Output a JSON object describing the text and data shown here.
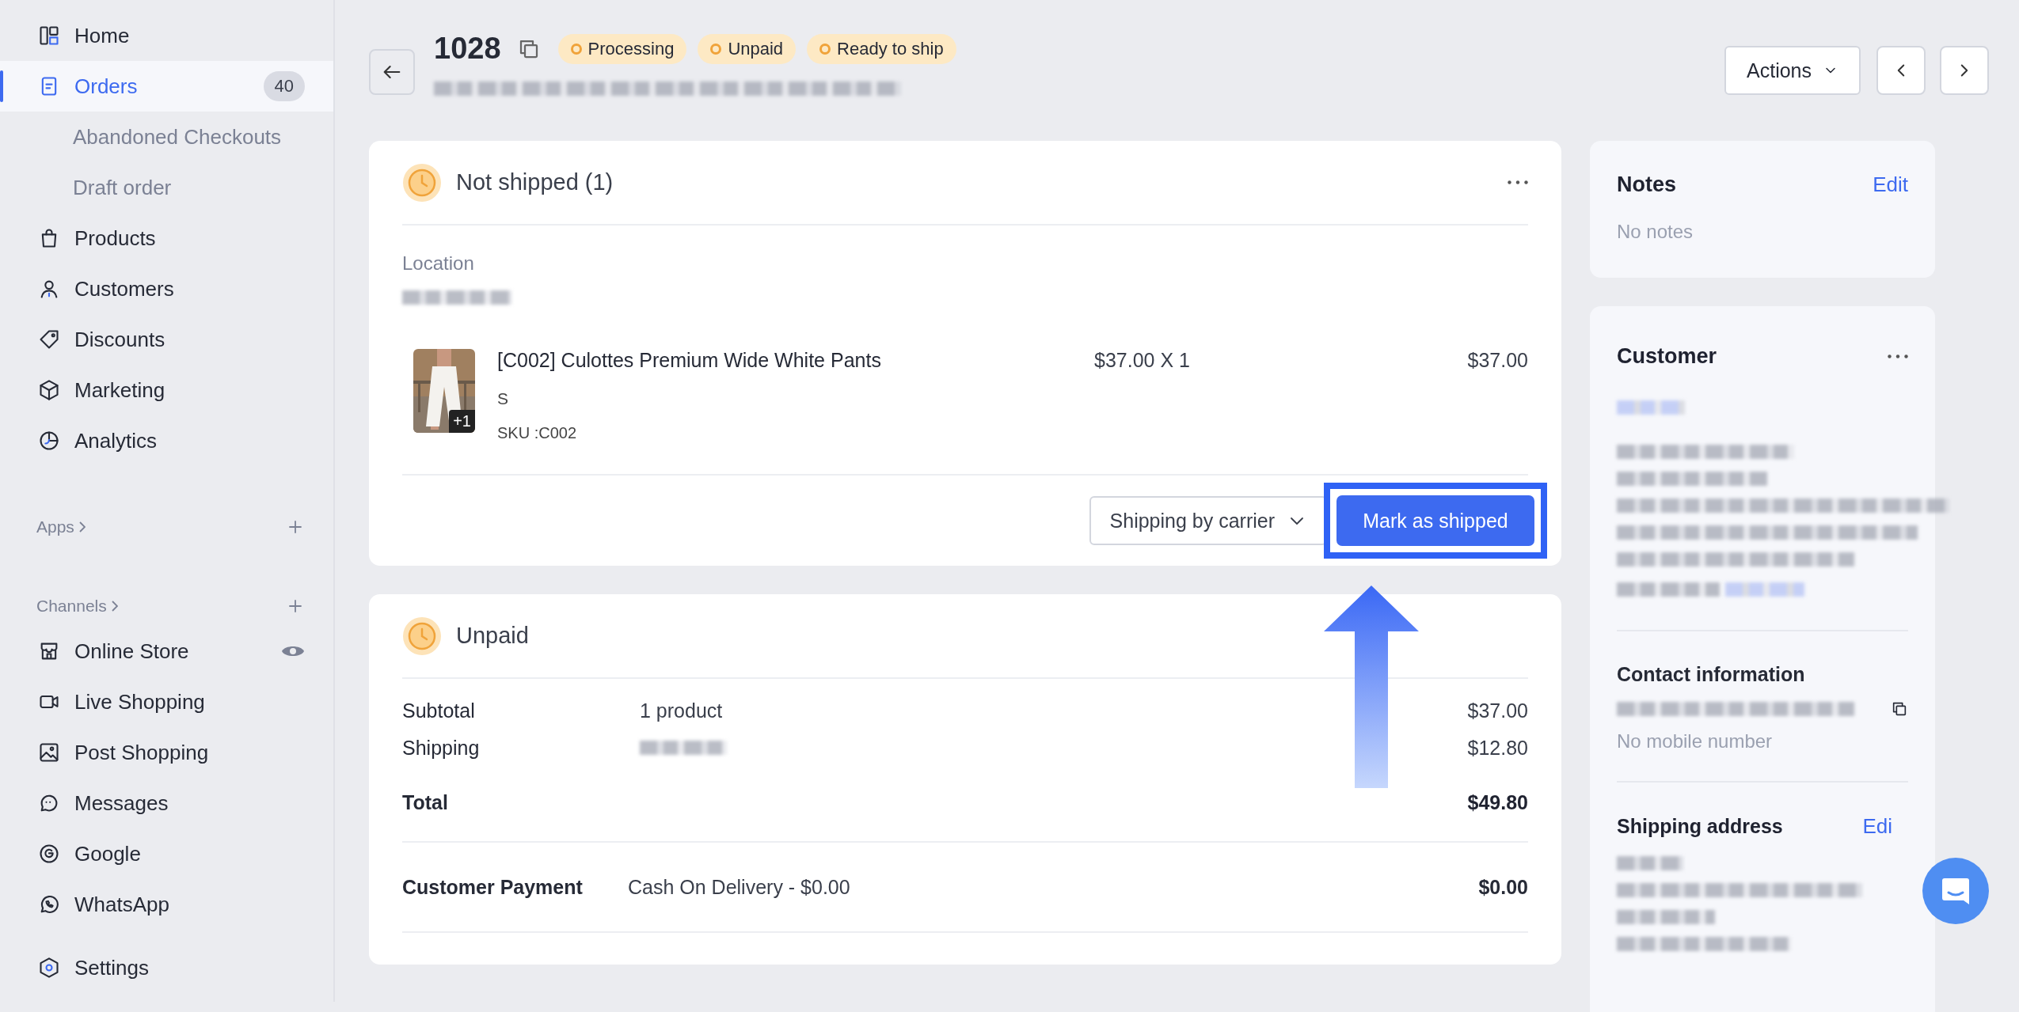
{
  "sidebar": {
    "items": [
      {
        "label": "Home",
        "kind": "main",
        "selected": false
      },
      {
        "label": "Orders",
        "kind": "main",
        "badge": "40",
        "selected": true
      },
      {
        "label": "Abandoned Checkouts",
        "kind": "sub",
        "selected": false
      },
      {
        "label": "Draft order",
        "kind": "sub",
        "selected": false
      },
      {
        "label": "Products",
        "kind": "main",
        "selected": false
      },
      {
        "label": "Customers",
        "kind": "main",
        "selected": false
      },
      {
        "label": "Discounts",
        "kind": "main",
        "selected": false
      },
      {
        "label": "Marketing",
        "kind": "main",
        "selected": false
      },
      {
        "label": "Analytics",
        "kind": "main",
        "selected": false
      }
    ],
    "sections": [
      {
        "title": "Apps"
      },
      {
        "title": "Channels",
        "items": [
          {
            "label": "Online Store",
            "selected": false
          },
          {
            "label": "Live Shopping",
            "selected": false
          },
          {
            "label": "Post Shopping",
            "selected": false
          },
          {
            "label": "Messages",
            "selected": false
          },
          {
            "label": "Google",
            "selected": false
          },
          {
            "label": "WhatsApp",
            "selected": false
          }
        ]
      }
    ],
    "footer": {
      "label": "Settings",
      "selected": false
    }
  },
  "header": {
    "order_number": "1028",
    "badges": [
      "Processing",
      "Unpaid",
      "Ready to ship"
    ],
    "actions": "Actions"
  },
  "fulfillment": {
    "title": "Not shipped (1)",
    "location_label": "Location",
    "items": [
      {
        "name": "[C002] Culottes Premium Wide White Pants",
        "variant": "S",
        "sku": "SKU :C002",
        "price": "$37.00 X 1",
        "total": "$37.00",
        "image_count": "+1"
      }
    ],
    "shipping_method": "Shipping by carrier",
    "primary_action": "Mark as shipped"
  },
  "payment": {
    "title": "Unpaid",
    "rows": [
      {
        "label": "Subtotal",
        "detail": "1 product",
        "amount": "$37.00",
        "kind": "line"
      },
      {
        "label": "Shipping",
        "amount": "$12.80",
        "kind": "line"
      },
      {
        "label": "Total",
        "amount": "$49.80",
        "kind": "total"
      }
    ],
    "customer_payment": {
      "label": "Customer Payment",
      "detail": "Cash On Delivery - $0.00",
      "amount": "$0.00"
    }
  },
  "notes": {
    "title": "Notes",
    "action": "Edit",
    "body": "No notes"
  },
  "customer": {
    "title": "Customer",
    "contact_title": "Contact information",
    "no_mobile": "No mobile number",
    "shipping_title": "Shipping address",
    "shipping_action": "Edi"
  }
}
